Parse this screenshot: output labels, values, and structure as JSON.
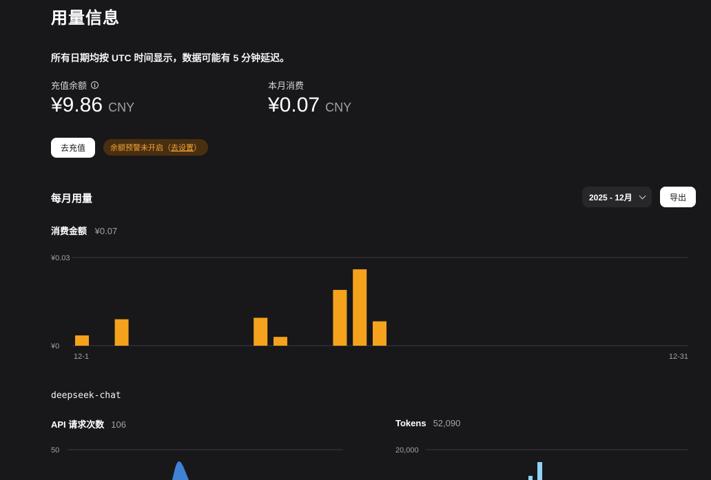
{
  "page": {
    "title": "用量信息",
    "notice": "所有日期均按 UTC 时间显示，数据可能有 5 分钟延迟。"
  },
  "balance": {
    "label": "充值余额",
    "amount": "¥9.86",
    "unit": "CNY",
    "topup_label": "去充值",
    "alert_text": "余额预警未开启（",
    "alert_link": "去设置",
    "alert_close": "）"
  },
  "monthly_spend": {
    "label": "本月消费",
    "amount": "¥0.07",
    "unit": "CNY"
  },
  "monthly_usage": {
    "title": "每月用量",
    "month_selected": "2025 - 12月",
    "export_label": "导出",
    "cost_label": "消费金额",
    "cost_value": "¥0.07"
  },
  "model": {
    "name": "deepseek-chat",
    "api_requests_label": "API 请求次数",
    "api_requests_value": "106",
    "tokens_label": "Tokens",
    "tokens_value": "52,090",
    "api_ytick": "50",
    "tokens_ytick": "20,000"
  },
  "colors": {
    "bar": "#f5a21d",
    "requests_area": "#3f82d6",
    "tokens_bar": "#8fd3f5"
  },
  "chart_data": [
    {
      "type": "bar",
      "x_start_label": "12-1",
      "x_end_label": "12-31",
      "y_ticks": [
        "¥0",
        "¥0.03"
      ],
      "ylim": [
        0,
        0.03
      ],
      "x": [
        1,
        2,
        3,
        4,
        5,
        6,
        7,
        8,
        9,
        10,
        11,
        12,
        13,
        14,
        15,
        16,
        17,
        18,
        19,
        20,
        21,
        22,
        23,
        24,
        25,
        26,
        27,
        28,
        29,
        30,
        31
      ],
      "values": [
        0.0035,
        0,
        0.009,
        0,
        0,
        0,
        0,
        0,
        0,
        0.0095,
        0.003,
        0,
        0,
        0.019,
        0.026,
        0.0083,
        0,
        0,
        0,
        0,
        0,
        0,
        0,
        0,
        0,
        0,
        0,
        0,
        0,
        0,
        0
      ]
    },
    {
      "type": "area",
      "label": "API 请求次数",
      "y_ticks": [
        "50"
      ],
      "ylim": [
        0,
        50
      ]
    },
    {
      "type": "bar",
      "label": "Tokens",
      "y_ticks": [
        "20,000"
      ],
      "ylim": [
        0,
        20000
      ]
    }
  ]
}
